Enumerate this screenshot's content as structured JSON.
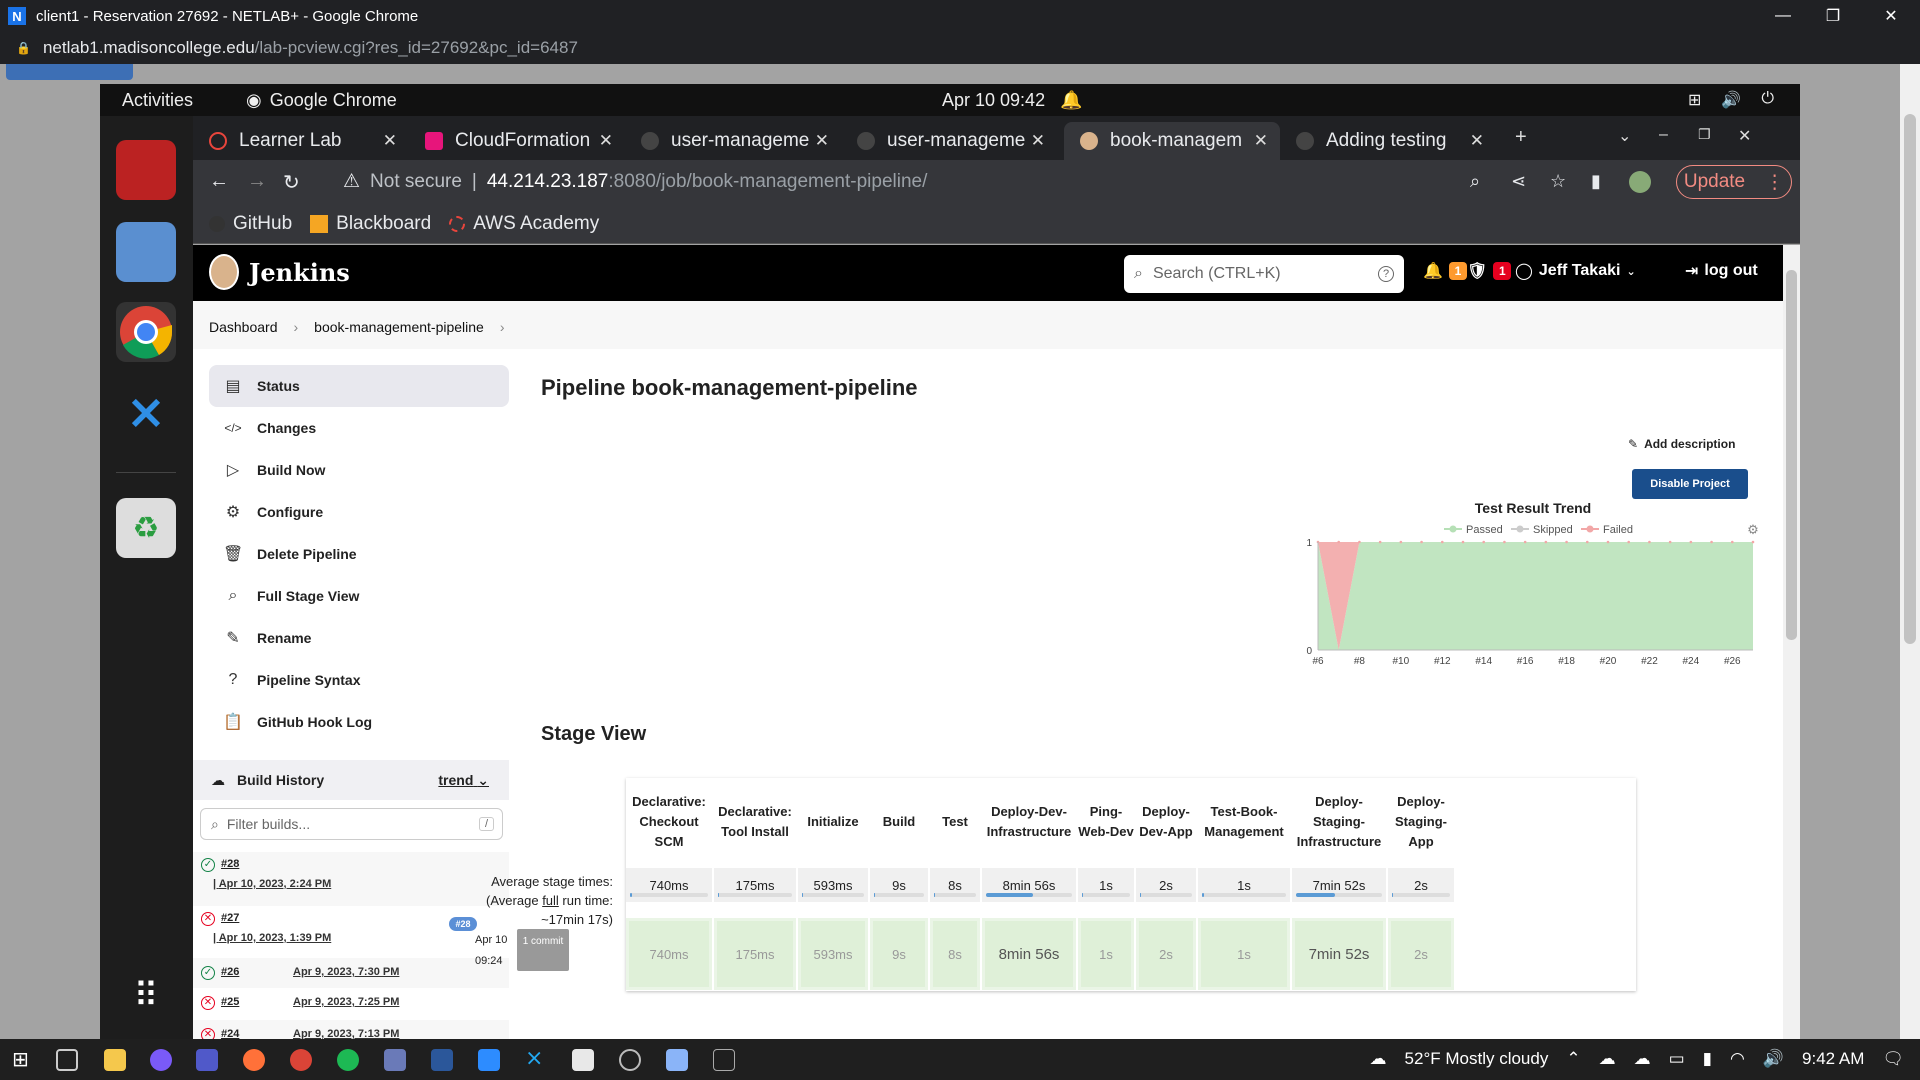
{
  "window": {
    "title": "client1 - Reservation 27692 - NETLAB+ - Google Chrome",
    "logo": "N",
    "url_host": "netlab1.madisoncollege.edu",
    "url_path": "/lab-pcview.cgi?res_id=27692&pc_id=6487",
    "controls": [
      "—",
      "❐",
      "✕"
    ]
  },
  "gnome": {
    "activities": "Activities",
    "app": "Google Chrome",
    "clock": "Apr 10  09:42"
  },
  "tabs": [
    {
      "label": "Learner Lab",
      "color": "#e8453c",
      "active": false
    },
    {
      "label": "CloudFormation",
      "color": "#e7157b",
      "active": false
    },
    {
      "label": "user-manageme",
      "color": "#444",
      "active": false
    },
    {
      "label": "user-manageme",
      "color": "#444",
      "active": false
    },
    {
      "label": "book-managem",
      "color": "#d9b38c",
      "active": true
    },
    {
      "label": "Adding testing",
      "color": "#444",
      "active": false
    }
  ],
  "toolbar": {
    "not_secure": "Not secure",
    "host": "44.214.23.187",
    "path": ":8080/job/book-management-pipeline/",
    "update": "Update"
  },
  "bookmarks": [
    {
      "label": "GitHub",
      "icon": "github-icon"
    },
    {
      "label": "Blackboard",
      "icon": "blackboard-icon"
    },
    {
      "label": "AWS Academy",
      "icon": "aws-academy-icon"
    }
  ],
  "jenkins": {
    "brand": "Jenkins",
    "search_placeholder": "Search (CTRL+K)",
    "notifications": "1",
    "security": "1",
    "user": "Jeff Takaki",
    "logout": "log out",
    "breadcrumb": [
      "Dashboard",
      "book-management-pipeline"
    ],
    "sidebar": [
      {
        "label": "Status",
        "icon": "status-icon",
        "glyph": "▤"
      },
      {
        "label": "Changes",
        "icon": "code-icon",
        "glyph": "</>"
      },
      {
        "label": "Build Now",
        "icon": "play-icon",
        "glyph": "▷"
      },
      {
        "label": "Configure",
        "icon": "gear-icon",
        "glyph": "⚙"
      },
      {
        "label": "Delete Pipeline",
        "icon": "trash-icon",
        "glyph": "🗑"
      },
      {
        "label": "Full Stage View",
        "icon": "search-icon",
        "glyph": "⌕"
      },
      {
        "label": "Rename",
        "icon": "pencil-icon",
        "glyph": "✎"
      },
      {
        "label": "Pipeline Syntax",
        "icon": "help-icon",
        "glyph": "?"
      },
      {
        "label": "GitHub Hook Log",
        "icon": "clipboard-icon",
        "glyph": "📋"
      }
    ],
    "build_history": {
      "title": "Build History",
      "trend": "trend",
      "filter_placeholder": "Filter builds...",
      "filter_key": "/",
      "builds": [
        {
          "num": "#28",
          "status": "ok",
          "date": "Apr 10, 2023, 2:24 PM"
        },
        {
          "num": "#27",
          "status": "fail",
          "date": "Apr 10, 2023, 1:39 PM"
        },
        {
          "num": "#26",
          "status": "ok",
          "date": "Apr 9, 2023, 7:30 PM"
        },
        {
          "num": "#25",
          "status": "fail",
          "date": "Apr 9, 2023, 7:25 PM"
        },
        {
          "num": "#24",
          "status": "fail",
          "date": "Apr 9, 2023, 7:13 PM"
        }
      ]
    },
    "title": "Pipeline book-management-pipeline",
    "add_description": "Add description",
    "disable_project": "Disable Project",
    "stage_view_title": "Stage View",
    "avg_label_1": "Average stage times:",
    "avg_label_2": "(Average ",
    "avg_label_full": "full",
    "avg_label_3": " run time: ~17min 17s)",
    "run": {
      "badge": "#28",
      "date": "Apr 10",
      "time": "09:24",
      "commit": "1 commit"
    },
    "stages": [
      {
        "name": "Declarative: Checkout SCM",
        "avg": "740ms",
        "cell": "740ms",
        "pct": 0.01
      },
      {
        "name": "Declarative: Tool Install",
        "avg": "175ms",
        "cell": "175ms",
        "pct": 0.005
      },
      {
        "name": "Initialize",
        "avg": "593ms",
        "cell": "593ms",
        "pct": 0.01
      },
      {
        "name": "Build",
        "avg": "9s",
        "cell": "9s",
        "pct": 0.02
      },
      {
        "name": "Test",
        "avg": "8s",
        "cell": "8s",
        "pct": 0.02
      },
      {
        "name": "Deploy-Dev-Infrastructure",
        "avg": "8min 56s",
        "cell": "8min 56s",
        "pct": 0.55
      },
      {
        "name": "Ping-Web-Dev",
        "avg": "1s",
        "cell": "1s",
        "pct": 0.01
      },
      {
        "name": "Deploy-Dev-App",
        "avg": "2s",
        "cell": "2s",
        "pct": 0.01
      },
      {
        "name": "Test-Book-Management",
        "avg": "1s",
        "cell": "1s",
        "pct": 0.01
      },
      {
        "name": "Deploy-Staging-Infrastructure",
        "avg": "7min 52s",
        "cell": "7min 52s",
        "pct": 0.45
      },
      {
        "name": "Deploy-Staging-App",
        "avg": "2s",
        "cell": "2s",
        "pct": 0.01
      }
    ]
  },
  "chart_data": {
    "type": "area",
    "title": "Test Result Trend",
    "legend": [
      "Passed",
      "Skipped",
      "Failed"
    ],
    "legend_position": "top",
    "colors": {
      "Passed": "#b6e0b6",
      "Skipped": "#cccccc",
      "Failed": "#f2a7a7"
    },
    "categories": [
      "#6",
      "#7",
      "#8",
      "#9",
      "#10",
      "#11",
      "#12",
      "#13",
      "#14",
      "#15",
      "#16",
      "#17",
      "#18",
      "#19",
      "#20",
      "#21",
      "#22",
      "#23",
      "#24",
      "#25",
      "#26",
      "#27"
    ],
    "tick_labels": [
      "#6",
      "#8",
      "#10",
      "#12",
      "#14",
      "#16",
      "#18",
      "#20",
      "#22",
      "#24",
      "#26"
    ],
    "series": [
      {
        "name": "Passed",
        "values": [
          1,
          0,
          1,
          1,
          1,
          1,
          1,
          1,
          1,
          1,
          1,
          1,
          1,
          1,
          1,
          1,
          1,
          1,
          1,
          1,
          1,
          1
        ]
      },
      {
        "name": "Skipped",
        "values": [
          0,
          0,
          0,
          0,
          0,
          0,
          0,
          0,
          0,
          0,
          0,
          0,
          0,
          0,
          0,
          0,
          0,
          0,
          0,
          0,
          0,
          0
        ]
      },
      {
        "name": "Failed",
        "values": [
          0,
          1,
          0,
          0,
          0,
          0,
          0,
          0,
          0,
          0,
          0,
          0,
          0,
          0,
          0,
          0,
          0,
          0,
          0,
          0,
          0,
          0
        ]
      }
    ],
    "ylim": [
      0,
      1
    ],
    "yticks": [
      "0",
      "1"
    ]
  },
  "taskbar": {
    "weather": "52°F  Mostly cloudy",
    "time": "9:42 AM"
  }
}
